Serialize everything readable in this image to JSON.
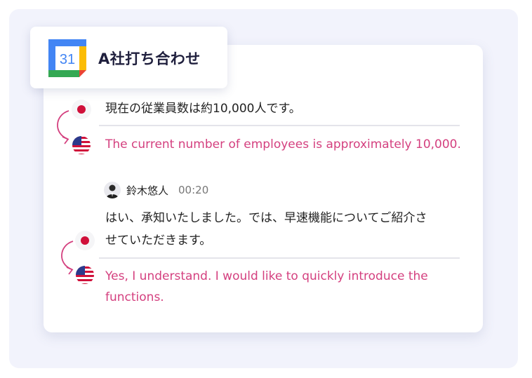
{
  "colors": {
    "background": "#f2f3fc",
    "card": "#ffffff",
    "translation_text": "#d4407f",
    "arrow": "#d4407f",
    "japan_red": "#d0103a"
  },
  "header": {
    "icon": "google-calendar-icon",
    "calendar_number": "31",
    "title": "A社打ち合わせ"
  },
  "messages": [
    {
      "japanese": "現在の従業員数は約10,000人です。",
      "english": "The current number of employees is approximately 10,000."
    },
    {
      "speaker": {
        "avatar": "avatar-icon",
        "name": "鈴木悠人",
        "time": "00:20"
      },
      "japanese_lines": [
        "はい、承知いたしました。では、早速機能についてご紹介さ",
        "せていただきます。"
      ],
      "english_lines": [
        "Yes, I understand. I would like to quickly introduce the",
        "functions."
      ]
    }
  ]
}
